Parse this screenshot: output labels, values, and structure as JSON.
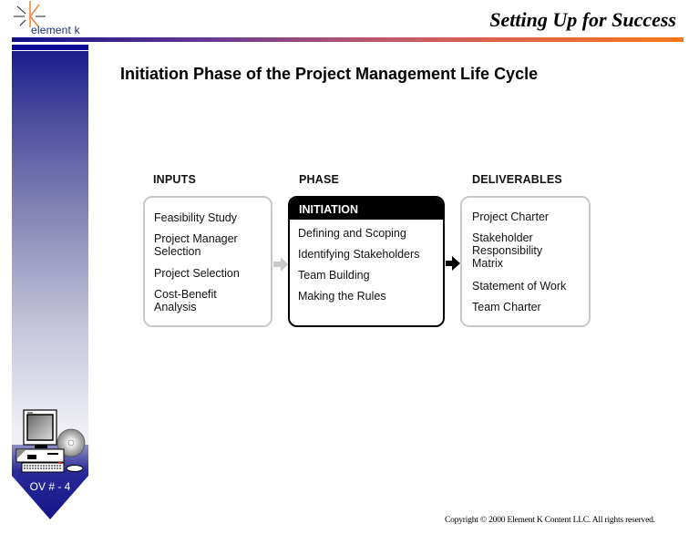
{
  "header": {
    "logo_text": "element k",
    "title": "Setting Up for Success"
  },
  "slide": {
    "title": "Initiation Phase of the Project Management Life Cycle",
    "badge_label": "OV # - 4"
  },
  "diagram": {
    "inputs": {
      "heading": "INPUTS",
      "items": [
        "Feasibility Study",
        "Project Manager\nSelection",
        "Project Selection",
        "Cost-Benefit\nAnalysis"
      ]
    },
    "phase": {
      "heading": "PHASE",
      "name": "INITIATION",
      "items": [
        "Defining and Scoping",
        "Identifying Stakeholders",
        "Team Building",
        "Making the Rules"
      ]
    },
    "deliverables": {
      "heading": "DELIVERABLES",
      "items": [
        "Project Charter",
        "Stakeholder\nResponsibility\nMatrix",
        "Statement of Work",
        "Team Charter"
      ]
    },
    "colors": {
      "input_border": "#c8c8c8",
      "phase_border": "#000000",
      "input_arrow": "#c8c8c8",
      "output_arrow": "#000000"
    }
  },
  "footer": {
    "copyright": "Copyright © 2000 Element K Content LLC. All rights reserved."
  }
}
